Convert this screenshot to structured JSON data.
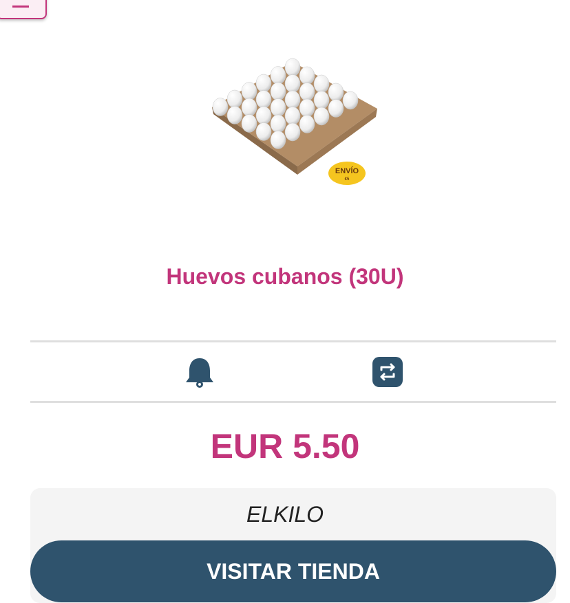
{
  "product": {
    "title": "Huevos cubanos (30U)",
    "price": "EUR 5.50",
    "image_badge": "ENVÍO",
    "image_badge_sub": "€5"
  },
  "actions": {
    "notify_icon": "bell-icon",
    "compare_icon": "swap-icon"
  },
  "store": {
    "name": "ELKILO",
    "visit_label": "VISITAR TIENDA"
  },
  "colors": {
    "accent": "#c2357b",
    "primary": "#2f536d",
    "card_bg": "#f4f4f4"
  }
}
